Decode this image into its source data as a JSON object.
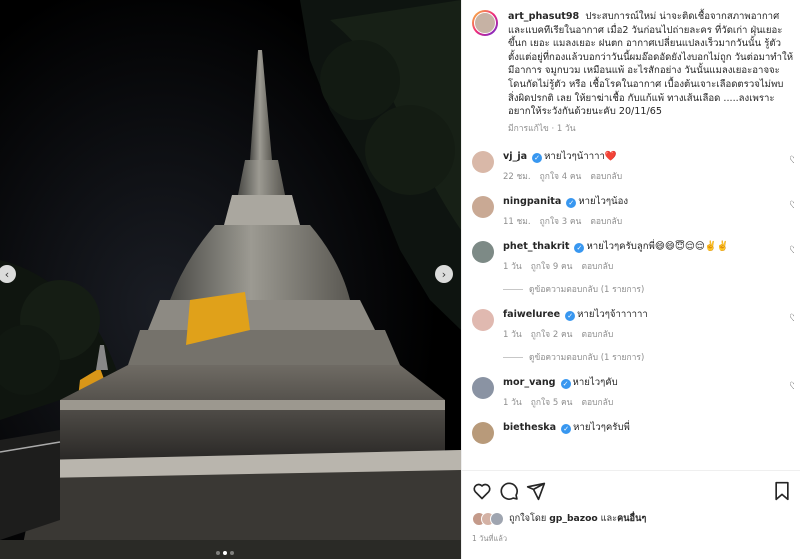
{
  "post": {
    "username": "art_phasut98",
    "caption": "ประสบการณ์ใหม่ น่าจะติดเชื้อจากสภาพอากาศ และแบคทีเรียในอากาศ เมื่อ2 วันก่อนไปถ่ายละคร ที่วัดเก่า ฝุ่นเยอะ ขึ้นก เยอะ แมลงเยอะ ฝนตก อากาศเปลี่ยนแปลงเร็วมากวันนั้น รู้ตัวตั้งแต่อยู่ที่กองแล้วบอกว่าวันนี้ผมอ๊อดอัดยังไงบอกไม่ถูก วันต่อมาทำให้มีอาการ จมูกบวม เหมือนแพ้ อะไรสักอย่าง วันนั้นแมลงเยอะอาจจะโดนกัดไม่รู้ตัว หรือ เชื้อโรคในอากาศ เบื้องต้นเจาะเลือดตรวจไม่พบ สิ่งผิดปรกติ เลย ให้ยาฆ่าเชื้อ กับแก้แพ้ ทางเส้นเลือด .....ลงเพราะอยากให้ระวังกันด้วยนะคับ 20/11/65",
    "edited": "มีการแก้ไข · 1 วัน"
  },
  "comments": [
    {
      "user": "vj_ja",
      "text": "หายไวๆน้าาาา❤️",
      "time": "22 ชม.",
      "likes": "ถูกใจ 4 คน",
      "reply": "ตอบกลับ",
      "avatar": "#d9b8a8"
    },
    {
      "user": "ningpanita",
      "text": "หายไวๆน้อง",
      "time": "11 ชม.",
      "likes": "ถูกใจ 3 คน",
      "reply": "ตอบกลับ",
      "avatar": "#c9a994"
    },
    {
      "user": "phet_thakrit",
      "text": "หายไวๆครับลูกพี่😄😄😇😌😌✌️✌️",
      "time": "1 วัน",
      "likes": "ถูกใจ 9 คน",
      "reply": "ตอบกลับ",
      "replies": "ดูข้อความตอบกลับ (1 รายการ)",
      "avatar": "#7d8a86"
    },
    {
      "user": "faiweluree",
      "text": "หายไวๆจ้าาาาาา",
      "time": "1 วัน",
      "likes": "ถูกใจ 2 คน",
      "reply": "ตอบกลับ",
      "replies": "ดูข้อความตอบกลับ (1 รายการ)",
      "avatar": "#e0b9b0"
    },
    {
      "user": "mor_vang",
      "text": "หายไวๆคับ",
      "time": "1 วัน",
      "likes": "ถูกใจ 5 คน",
      "reply": "ตอบกลับ",
      "avatar": "#8a93a3"
    },
    {
      "user": "bietheska",
      "text": "หายไวๆครับพี่",
      "time": "",
      "likes": "",
      "reply": "",
      "avatar": "#b89a7a"
    }
  ],
  "likes": {
    "prefix": "ถูกใจโดย",
    "user": "gp_bazoo",
    "suffix": "และ",
    "others": "คนอื่นๆ"
  },
  "timestamp": "1 วันที่แล้ว",
  "icons": [
    "heart-icon",
    "comment-icon",
    "share-icon",
    "bookmark-icon",
    "chevron-left-icon",
    "chevron-right-icon"
  ]
}
